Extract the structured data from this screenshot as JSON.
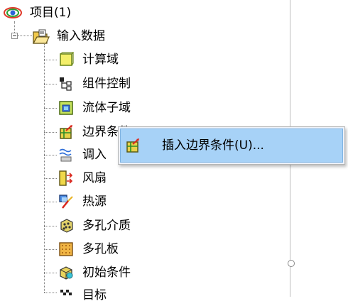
{
  "tree": {
    "root": {
      "label": "项目(1)"
    },
    "input_data": {
      "label": "输入数据"
    },
    "items": [
      {
        "label": "计算域",
        "icon": "domain-icon"
      },
      {
        "label": "组件控制",
        "icon": "component-control-icon"
      },
      {
        "label": "流体子域",
        "icon": "fluid-subdomain-icon"
      },
      {
        "label": "边界条件",
        "icon": "boundary-condition-icon"
      },
      {
        "label": "调入",
        "icon": "import-icon"
      },
      {
        "label": "风扇",
        "icon": "fan-icon"
      },
      {
        "label": "热源",
        "icon": "heat-source-icon"
      },
      {
        "label": "多孔介质",
        "icon": "porous-media-icon"
      },
      {
        "label": "多孔板",
        "icon": "perforated-plate-icon"
      },
      {
        "label": "初始条件",
        "icon": "initial-condition-icon"
      },
      {
        "label": "目标",
        "icon": "goal-icon"
      }
    ]
  },
  "context_menu": {
    "items": [
      {
        "label": "插入边界条件(U)...",
        "icon": "insert-boundary-condition-icon"
      }
    ]
  }
}
